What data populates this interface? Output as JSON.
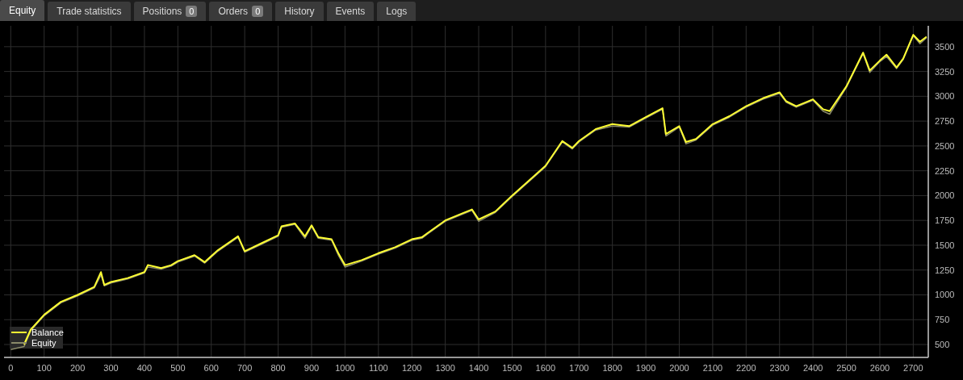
{
  "tabs": [
    {
      "label": "Equity",
      "selected": true
    },
    {
      "label": "Trade statistics",
      "selected": false
    },
    {
      "label": "Positions",
      "badge": "0",
      "selected": false
    },
    {
      "label": "Orders",
      "badge": "0",
      "selected": false
    },
    {
      "label": "History",
      "selected": false
    },
    {
      "label": "Events",
      "selected": false
    },
    {
      "label": "Logs",
      "selected": false
    }
  ],
  "chart": {
    "chart_data": {
      "type": "line",
      "x": [
        0,
        40,
        60,
        100,
        150,
        200,
        250,
        270,
        280,
        300,
        350,
        400,
        410,
        450,
        480,
        500,
        550,
        580,
        620,
        680,
        700,
        750,
        800,
        810,
        850,
        880,
        900,
        920,
        960,
        980,
        1000,
        1050,
        1100,
        1150,
        1200,
        1230,
        1250,
        1300,
        1350,
        1380,
        1400,
        1450,
        1500,
        1550,
        1600,
        1620,
        1650,
        1680,
        1700,
        1750,
        1800,
        1850,
        1900,
        1950,
        1960,
        2000,
        2020,
        2050,
        2100,
        2150,
        2200,
        2250,
        2300,
        2320,
        2350,
        2400,
        2430,
        2450,
        2500,
        2550,
        2570,
        2600,
        2620,
        2650,
        2670,
        2700,
        2720,
        2740
      ],
      "series": [
        {
          "name": "Balance",
          "color": "#ffff33",
          "values": [
            null,
            500,
            650,
            800,
            930,
            1000,
            1080,
            1230,
            1100,
            1130,
            1170,
            1230,
            1300,
            1270,
            1300,
            1340,
            1400,
            1330,
            1450,
            1590,
            1440,
            1520,
            1600,
            1690,
            1720,
            1590,
            1700,
            1580,
            1560,
            1420,
            1300,
            1350,
            1420,
            1480,
            1560,
            1580,
            1630,
            1750,
            1820,
            1860,
            1760,
            1840,
            2000,
            2150,
            2300,
            2400,
            2550,
            2480,
            2550,
            2670,
            2720,
            2700,
            2790,
            2880,
            2620,
            2700,
            2540,
            2570,
            2720,
            2800,
            2900,
            2980,
            3040,
            2950,
            2900,
            2970,
            2870,
            2850,
            3100,
            3440,
            3260,
            3360,
            3420,
            3290,
            3380,
            3620,
            3550,
            3600
          ]
        },
        {
          "name": "Equity",
          "color": "#8a8a6a",
          "values": [
            450,
            480,
            640,
            790,
            920,
            990,
            1070,
            1200,
            1090,
            1120,
            1160,
            1220,
            1280,
            1260,
            1290,
            1330,
            1390,
            1320,
            1440,
            1580,
            1430,
            1510,
            1590,
            1680,
            1710,
            1570,
            1690,
            1570,
            1550,
            1400,
            1280,
            1340,
            1410,
            1470,
            1550,
            1570,
            1620,
            1740,
            1810,
            1850,
            1740,
            1830,
            1990,
            2140,
            2290,
            2390,
            2540,
            2470,
            2540,
            2660,
            2700,
            2690,
            2780,
            2870,
            2600,
            2690,
            2520,
            2560,
            2710,
            2790,
            2890,
            2970,
            3030,
            2940,
            2890,
            2960,
            2850,
            2820,
            3090,
            3430,
            3240,
            3350,
            3400,
            3280,
            3370,
            3610,
            3530,
            3590
          ]
        }
      ],
      "grid": true,
      "legend": true,
      "xlim": [
        -20,
        2745
      ],
      "ylim": [
        370,
        3710
      ],
      "xticks": [
        {
          "value": 0,
          "label": "0"
        },
        100,
        200,
        300,
        400,
        500,
        600,
        700,
        800,
        900,
        1000,
        1100,
        1200,
        1300,
        1400,
        1500,
        1600,
        1700,
        1800,
        1900,
        2000,
        2100,
        2200,
        2300,
        2400,
        2500,
        2600,
        2700
      ],
      "yticks": [
        500,
        750,
        1000,
        1250,
        1500,
        1750,
        2000,
        2250,
        2500,
        2750,
        3000,
        3250,
        3500
      ]
    }
  }
}
